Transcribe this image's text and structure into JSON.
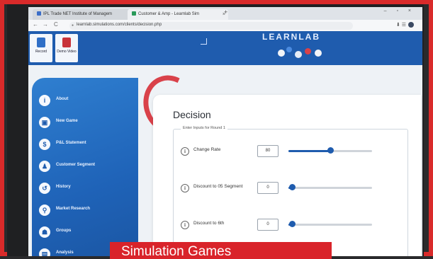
{
  "browser": {
    "tabs": [
      {
        "label": "IPL Trade NET Institute of Managem",
        "color": "#3b6ec8"
      },
      {
        "label": "Customer & Amp - Learnlab Sim",
        "color": "#2a9a5a"
      }
    ],
    "new_tab": "+",
    "window_controls": "– ▫ ×",
    "back": "←",
    "forward": "→",
    "reload": "C",
    "url": "learnlab.simulations.com/clients/decision.php"
  },
  "header": {
    "buttons": [
      {
        "label": "Record",
        "icon": "record-icon",
        "color": "#2f6fc7"
      },
      {
        "label": "Demo Video",
        "icon": "video-icon",
        "color": "#c8333a"
      }
    ],
    "brand": "LEARNLAB"
  },
  "sidebar": {
    "items": [
      {
        "label": "About",
        "icon": "info-icon",
        "glyph": "i"
      },
      {
        "label": "New Game",
        "icon": "game-icon",
        "glyph": "▣"
      },
      {
        "label": "P&L Statement",
        "icon": "statement-icon",
        "glyph": "$"
      },
      {
        "label": "Customer Segment",
        "icon": "customer-icon",
        "glyph": "♟"
      },
      {
        "label": "History",
        "icon": "history-icon",
        "glyph": "↺"
      },
      {
        "label": "Market Research",
        "icon": "research-icon",
        "glyph": "⚲"
      },
      {
        "label": "Groups",
        "icon": "groups-icon",
        "glyph": "☗"
      },
      {
        "label": "Analysis",
        "icon": "analysis-icon",
        "glyph": "▤"
      }
    ]
  },
  "decision": {
    "title": "Decision",
    "legend": "Enter Inputs for Round 1",
    "rows": [
      {
        "label": "Change Rate",
        "value": "80",
        "level": 0.5
      },
      {
        "label": "Discount to 05 Segment",
        "value": "0",
        "level": 0.0
      },
      {
        "label": "Discount to 6th",
        "value": "0",
        "level": 0.0
      }
    ]
  },
  "caption": {
    "text": "Simulation Games"
  },
  "colors": {
    "accent": "#1f5cae",
    "frame": "#d92a2a",
    "caption_bg": "#d9232a"
  }
}
